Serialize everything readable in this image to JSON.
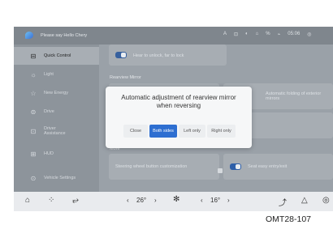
{
  "status_bar": {
    "voice_prompt": "Please say Hello Chery",
    "icons": [
      "A",
      "⊡",
      "◐",
      "⌂",
      "%",
      "⌁",
      "05:06",
      "◎"
    ]
  },
  "sidebar": {
    "items": [
      {
        "icon": "⊟",
        "label": "Quick Control",
        "active": true
      },
      {
        "icon": "☼",
        "label": "Light",
        "active": false
      },
      {
        "icon": "☆",
        "label": "New Energy",
        "active": false
      },
      {
        "icon": "⊜",
        "label": "Drive",
        "active": false
      },
      {
        "icon": "⊡",
        "label": "Driver Assistance",
        "active": false
      },
      {
        "icon": "⊞",
        "label": "HUD",
        "active": false
      },
      {
        "icon": "⊙",
        "label": "Vehicle Settings",
        "active": false
      }
    ]
  },
  "main": {
    "top_card": "Hear to unlock, far to lock",
    "rearview_title": "Rearview Mirror",
    "rearview_right_card": "Automatic folding of exterior mirrors",
    "more_title": "More",
    "steering_card": "Steering wheel button customization",
    "seat_card": "Seat easy entry/exit"
  },
  "dialog": {
    "title": "Automatic adjustment of rearview mirror when reversing",
    "options": [
      {
        "label": "Close",
        "selected": false
      },
      {
        "label": "Both sides",
        "selected": true
      },
      {
        "label": "Left only",
        "selected": false
      },
      {
        "label": "Right only",
        "selected": false
      }
    ]
  },
  "bottom_bar": {
    "home_icon": "⌂",
    "apps_icon": "⁘",
    "car_icon": "⥂",
    "left_temp": "26°",
    "left_temp_less": "‹",
    "left_temp_more": "›",
    "fan_icon": "✻",
    "right_temp": "16°",
    "right_temp_less": "‹",
    "right_temp_more": "›",
    "seat_icon": "⤴",
    "warning_icon": "△",
    "settings_icon": "◎"
  },
  "caption": "OMT28-107",
  "colors": {
    "accent": "#2e6fd1",
    "overlay_bg": "#9aa1a8",
    "dialog_bg": "#f6f7f8"
  }
}
